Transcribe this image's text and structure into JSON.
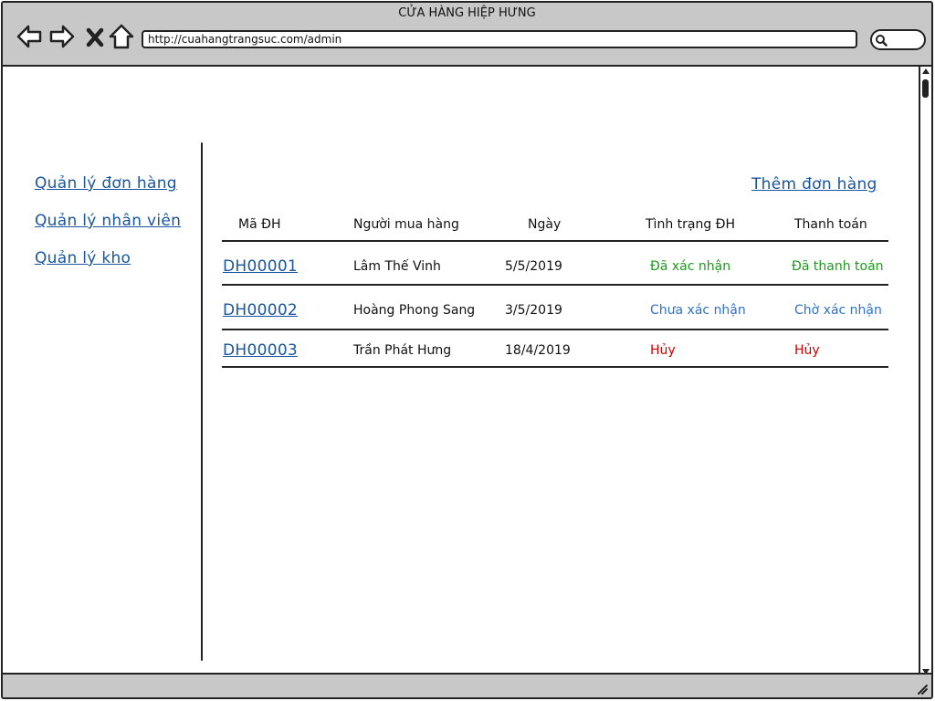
{
  "window": {
    "title": "CỬA HÀNG HIỆP HƯNG",
    "url": "http://cuahangtrangsuc.com/admin"
  },
  "sidebar": {
    "items": [
      {
        "label": "Quản lý đơn hàng"
      },
      {
        "label": "Quản lý nhân viên"
      },
      {
        "label": "Quản lý kho"
      }
    ]
  },
  "main": {
    "add_order_label": "Thêm đơn hàng",
    "table": {
      "headers": {
        "code": "Mã ĐH",
        "buyer": "Người mua hàng",
        "date": "Ngày",
        "order_status": "Tình trạng ĐH",
        "payment": "Thanh toán"
      },
      "rows": [
        {
          "code": "DH00001",
          "buyer": "Lâm Thế Vinh",
          "date": "5/5/2019",
          "order_status": "Đã xác nhận",
          "payment": "Đã thanh toán"
        },
        {
          "code": "DH00002",
          "buyer": "Hoàng Phong Sang",
          "date": "3/5/2019",
          "order_status": "Chưa xác nhận",
          "payment": "Chờ xác nhận"
        },
        {
          "code": "DH00003",
          "buyer": "Trần Phát Hưng",
          "date": "18/4/2019",
          "order_status": "Hủy",
          "payment": "Hủy"
        }
      ]
    }
  },
  "colors": {
    "link": "#1a56a0",
    "confirmed": "#1e9a1e",
    "pending": "#2f72c9",
    "cancelled": "#cc0000"
  },
  "icons": [
    "back-arrow-icon",
    "forward-arrow-icon",
    "close-icon",
    "home-icon",
    "search-icon",
    "resize-grip-icon"
  ]
}
